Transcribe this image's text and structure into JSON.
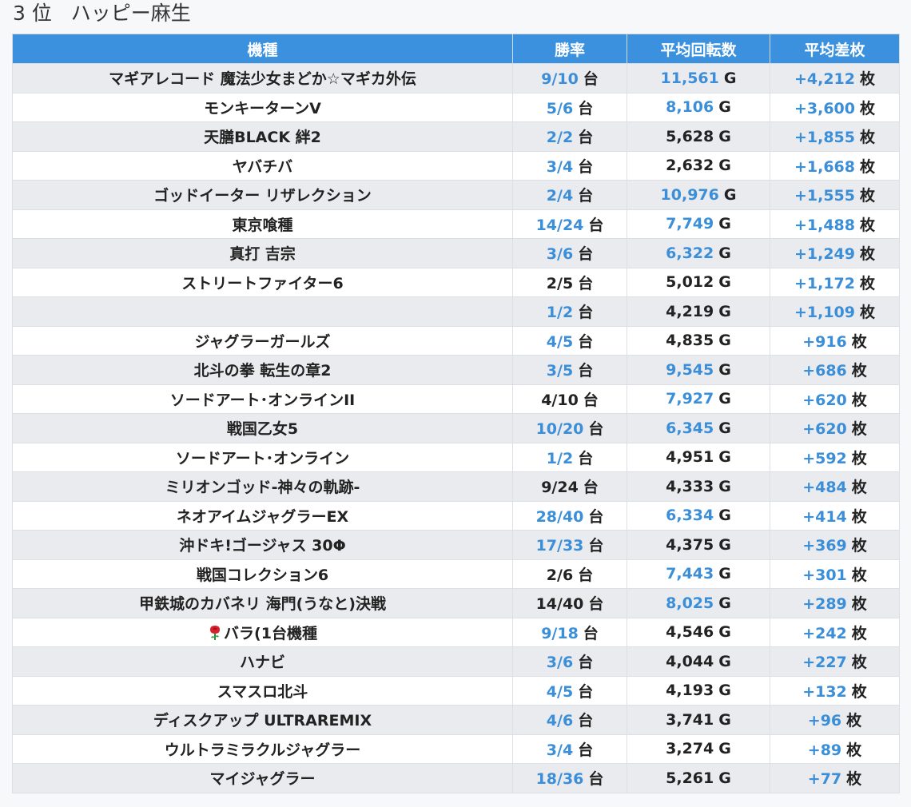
{
  "title": {
    "rank": "3",
    "rank_suffix": "位",
    "store": "ハッピー麻生"
  },
  "table": {
    "headers": {
      "machine": "機種",
      "win_rate": "勝率",
      "avg_spins": "平均回転数",
      "avg_diff": "平均差枚"
    },
    "units": {
      "machines": "台",
      "games": "G",
      "medals": "枚"
    },
    "rows": [
      {
        "name": "マギアレコード 魔法少女まどか☆マギカ外伝",
        "win": "9/10",
        "spins": "11,561",
        "diff": "+4,212",
        "win_hl": true,
        "spins_hl": true
      },
      {
        "name": "モンキーターンV",
        "win": "5/6",
        "spins": "8,106",
        "diff": "+3,600",
        "win_hl": true,
        "spins_hl": true
      },
      {
        "name": "天膳BLACK 絆2",
        "win": "2/2",
        "spins": "5,628",
        "diff": "+1,855",
        "win_hl": true,
        "spins_hl": false
      },
      {
        "name": "ヤバチバ",
        "win": "3/4",
        "spins": "2,632",
        "diff": "+1,668",
        "win_hl": true,
        "spins_hl": false
      },
      {
        "name": "ゴッドイーター リザレクション",
        "win": "2/4",
        "spins": "10,976",
        "diff": "+1,555",
        "win_hl": true,
        "spins_hl": true
      },
      {
        "name": "東京喰種",
        "win": "14/24",
        "spins": "7,749",
        "diff": "+1,488",
        "win_hl": true,
        "spins_hl": true
      },
      {
        "name": "真打 吉宗",
        "win": "3/6",
        "spins": "6,322",
        "diff": "+1,249",
        "win_hl": true,
        "spins_hl": true
      },
      {
        "name": "ストリートファイター6",
        "win": "2/5",
        "spins": "5,012",
        "diff": "+1,172",
        "win_hl": false,
        "spins_hl": false
      },
      {
        "name": "",
        "win": "1/2",
        "spins": "4,219",
        "diff": "+1,109",
        "win_hl": true,
        "spins_hl": false
      },
      {
        "name": "ジャグラーガールズ",
        "win": "4/5",
        "spins": "4,835",
        "diff": "+916",
        "win_hl": true,
        "spins_hl": false
      },
      {
        "name": "北斗の拳 転生の章2",
        "win": "3/5",
        "spins": "9,545",
        "diff": "+686",
        "win_hl": true,
        "spins_hl": true
      },
      {
        "name": "ソードアート･オンラインII",
        "win": "4/10",
        "spins": "7,927",
        "diff": "+620",
        "win_hl": false,
        "spins_hl": true
      },
      {
        "name": "戦国乙女5",
        "win": "10/20",
        "spins": "6,345",
        "diff": "+620",
        "win_hl": true,
        "spins_hl": true
      },
      {
        "name": "ソードアート･オンライン",
        "win": "1/2",
        "spins": "4,951",
        "diff": "+592",
        "win_hl": true,
        "spins_hl": false
      },
      {
        "name": "ミリオンゴッド-神々の軌跡-",
        "win": "9/24",
        "spins": "4,333",
        "diff": "+484",
        "win_hl": false,
        "spins_hl": false
      },
      {
        "name": "ネオアイムジャグラーEX",
        "win": "28/40",
        "spins": "6,334",
        "diff": "+414",
        "win_hl": true,
        "spins_hl": true
      },
      {
        "name": "沖ドキ!ゴージャス 30Φ",
        "win": "17/33",
        "spins": "4,375",
        "diff": "+369",
        "win_hl": true,
        "spins_hl": false
      },
      {
        "name": "戦国コレクション6",
        "win": "2/6",
        "spins": "7,443",
        "diff": "+301",
        "win_hl": false,
        "spins_hl": true
      },
      {
        "name": "甲鉄城のカバネリ 海門(うなと)決戦",
        "win": "14/40",
        "spins": "8,025",
        "diff": "+289",
        "win_hl": false,
        "spins_hl": true
      },
      {
        "name": "バラ(1台機種",
        "win": "9/18",
        "spins": "4,546",
        "diff": "+242",
        "win_hl": true,
        "spins_hl": false,
        "icon": "rose-icon"
      },
      {
        "name": "ハナビ",
        "win": "3/6",
        "spins": "4,044",
        "diff": "+227",
        "win_hl": true,
        "spins_hl": false
      },
      {
        "name": "スマスロ北斗",
        "win": "4/5",
        "spins": "4,193",
        "diff": "+132",
        "win_hl": true,
        "spins_hl": false
      },
      {
        "name": "ディスクアップ ULTRAREMIX",
        "win": "4/6",
        "spins": "3,741",
        "diff": "+96",
        "win_hl": true,
        "spins_hl": false
      },
      {
        "name": "ウルトラミラクルジャグラー",
        "win": "3/4",
        "spins": "3,274",
        "diff": "+89",
        "win_hl": true,
        "spins_hl": false
      },
      {
        "name": "マイジャグラー",
        "win": "18/36",
        "spins": "5,261",
        "diff": "+77",
        "win_hl": true,
        "spins_hl": false
      }
    ]
  },
  "colors": {
    "header_bg": "#3b91dd",
    "highlight": "#3b8ed8",
    "row_alt": "#eaebee"
  }
}
